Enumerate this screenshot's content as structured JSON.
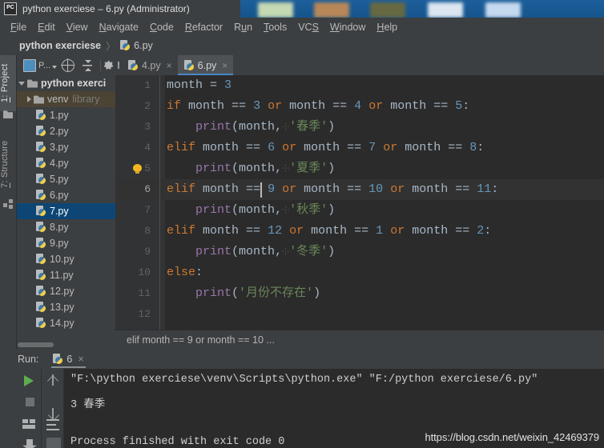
{
  "window": {
    "title": "python exerciese – 6.py (Administrator)",
    "app_icon": "pycharm-logo-icon"
  },
  "menubar": {
    "items": [
      {
        "label": "File",
        "mnemonic": "F"
      },
      {
        "label": "Edit",
        "mnemonic": "E"
      },
      {
        "label": "View",
        "mnemonic": "V"
      },
      {
        "label": "Navigate",
        "mnemonic": "N"
      },
      {
        "label": "Code",
        "mnemonic": "C"
      },
      {
        "label": "Refactor",
        "mnemonic": "R"
      },
      {
        "label": "Run",
        "mnemonic": "u"
      },
      {
        "label": "Tools",
        "mnemonic": "T"
      },
      {
        "label": "VCS",
        "mnemonic": "S"
      },
      {
        "label": "Window",
        "mnemonic": "W"
      },
      {
        "label": "Help",
        "mnemonic": "H"
      }
    ]
  },
  "navbar": {
    "project": "python exerciese",
    "separator": "〉",
    "file": "6.py"
  },
  "left_stripe": {
    "project_button": "1: Project",
    "structure_button": "7: Structure"
  },
  "project_panel": {
    "toolbar": {
      "view_selector": "P...",
      "locate_icon": "locate-target-icon",
      "collapse_icon": "collapse-all-icon",
      "settings_icon": "gear-icon"
    },
    "tree": [
      {
        "label": "python exerci",
        "type": "folder",
        "depth": 0,
        "expanded": true,
        "bold": true,
        "selected": false,
        "sub": ""
      },
      {
        "label": "venv",
        "type": "folder",
        "depth": 1,
        "expanded": false,
        "bold": false,
        "selected": false,
        "sub": "library"
      },
      {
        "label": "1.py",
        "type": "python",
        "depth": 2,
        "selected": false,
        "sub": ""
      },
      {
        "label": "2.py",
        "type": "python",
        "depth": 2,
        "selected": false,
        "sub": ""
      },
      {
        "label": "3.py",
        "type": "python",
        "depth": 2,
        "selected": false,
        "sub": ""
      },
      {
        "label": "4.py",
        "type": "python",
        "depth": 2,
        "selected": false,
        "sub": ""
      },
      {
        "label": "5.py",
        "type": "python",
        "depth": 2,
        "selected": false,
        "sub": ""
      },
      {
        "label": "6.py",
        "type": "python",
        "depth": 2,
        "selected": false,
        "sub": ""
      },
      {
        "label": "7.py",
        "type": "python",
        "depth": 2,
        "selected": true,
        "sub": ""
      },
      {
        "label": "8.py",
        "type": "python",
        "depth": 2,
        "selected": false,
        "sub": ""
      },
      {
        "label": "9.py",
        "type": "python",
        "depth": 2,
        "selected": false,
        "sub": ""
      },
      {
        "label": "10.py",
        "type": "python",
        "depth": 2,
        "selected": false,
        "sub": ""
      },
      {
        "label": "11.py",
        "type": "python",
        "depth": 2,
        "selected": false,
        "sub": ""
      },
      {
        "label": "12.py",
        "type": "python",
        "depth": 2,
        "selected": false,
        "sub": ""
      },
      {
        "label": "13.py",
        "type": "python",
        "depth": 2,
        "selected": false,
        "sub": ""
      },
      {
        "label": "14.py",
        "type": "python",
        "depth": 2,
        "selected": false,
        "sub": ""
      }
    ]
  },
  "editor": {
    "tabs": [
      {
        "label": "4.py",
        "active": false,
        "close": "×"
      },
      {
        "label": "6.py",
        "active": true,
        "close": "×"
      }
    ],
    "current_line": 6,
    "line_numbers": [
      "1",
      "2",
      "3",
      "4",
      "5",
      "6",
      "7",
      "8",
      "9",
      "10",
      "11",
      "12"
    ],
    "lines": [
      {
        "n": 1,
        "text": "month = 3"
      },
      {
        "n": 2,
        "text": "if month == 3 or month == 4 or month == 5:"
      },
      {
        "n": 3,
        "text": "    print(month,'春季')"
      },
      {
        "n": 4,
        "text": "elif month == 6 or month == 7 or month == 8:"
      },
      {
        "n": 5,
        "text": "    print(month,'夏季')"
      },
      {
        "n": 6,
        "text": "elif month == 9 or month == 10 or month == 11:"
      },
      {
        "n": 7,
        "text": "    print(month,'秋季')"
      },
      {
        "n": 8,
        "text": "elif month == 12 or month == 1 or month == 2:"
      },
      {
        "n": 9,
        "text": "    print(month,'冬季')"
      },
      {
        "n": 10,
        "text": "else:"
      },
      {
        "n": 11,
        "text": "    print('月份不存在')"
      },
      {
        "n": 12,
        "text": ""
      }
    ],
    "intention_bulb_line": 5,
    "breadcrumb": "elif month == 9 or month == 10 ..."
  },
  "run_panel": {
    "title": "Run:",
    "tab_label": "6",
    "tab_close": "×",
    "toolbar": {
      "run_icon": "run-play-icon",
      "stop_icon": "stop-icon",
      "rerun_icon": "rerun-icon",
      "trash_icon": "clear-all-icon",
      "up_icon": "previous-occurrence-icon",
      "down_icon": "next-occurrence-icon",
      "wrap_icon": "soft-wrap-icon",
      "scroll_end_icon": "scroll-to-end-icon"
    },
    "console": [
      "\"F:\\python exerciese\\venv\\Scripts\\python.exe\" \"F:/python exerciese/6.py\"",
      "3 春季",
      "",
      "Process finished with exit code 0"
    ]
  },
  "watermark": "https://blog.csdn.net/weixin_42469379",
  "colors": {
    "titlebar_blue": "#1b5c96",
    "ide_chrome": "#3c3f41",
    "editor_bg": "#2b2b2b",
    "gutter_bg": "#313335",
    "selection_blue": "#0d4675",
    "tab_underline": "#4a88c7",
    "keyword_orange": "#cc7832",
    "number_blue": "#6897bb",
    "string_green": "#6a8759",
    "function_purple": "#9876aa",
    "text_default": "#a9b7c6",
    "bulb_yellow": "#f5b721",
    "run_green": "#5cad4f"
  }
}
